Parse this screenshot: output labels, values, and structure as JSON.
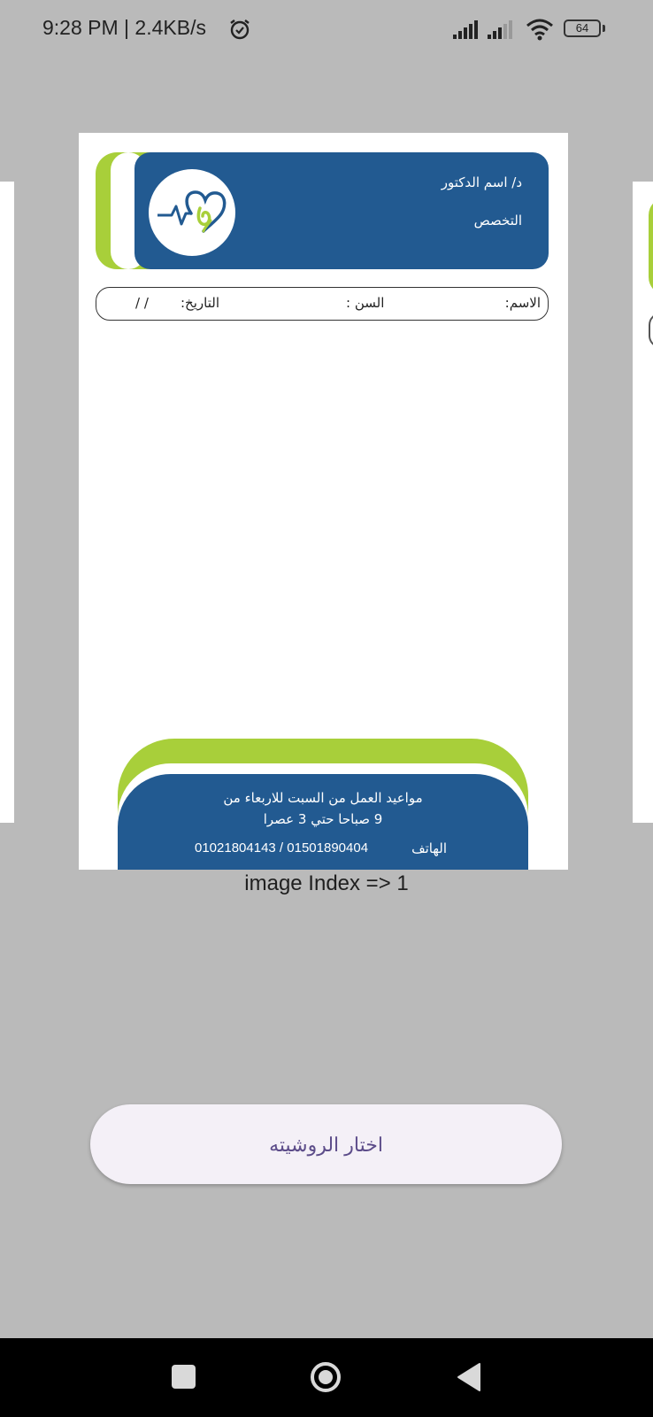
{
  "status_bar": {
    "time": "9:28 PM | 2.4KB/s",
    "battery": "64",
    "icons": [
      "alarm-icon",
      "signal-icon",
      "signal-icon",
      "wifi-icon",
      "battery-icon"
    ]
  },
  "prescription": {
    "doctor_name": "د/ اسم الدكتور",
    "specialty": "التخصص",
    "name_label": "الاسم:",
    "age_label": "السن :",
    "date_label": "التاريخ:",
    "date_placeholder": "/     /",
    "working_hours_line1": "مواعيد العمل من السبت للاربعاء من",
    "working_hours_line2": "9 صباحا حتي  3 عصرا",
    "phone_label": "الهاتف",
    "phone_numbers": "01021804143  /  01501890404",
    "colors": {
      "blue": "#225a91",
      "green": "#a8cf3a"
    }
  },
  "caption": "image Index => 1",
  "choose_button": {
    "label": "اختار الروشيته"
  },
  "nav": {
    "icons": [
      "recent-apps-icon",
      "home-icon",
      "back-icon"
    ]
  }
}
